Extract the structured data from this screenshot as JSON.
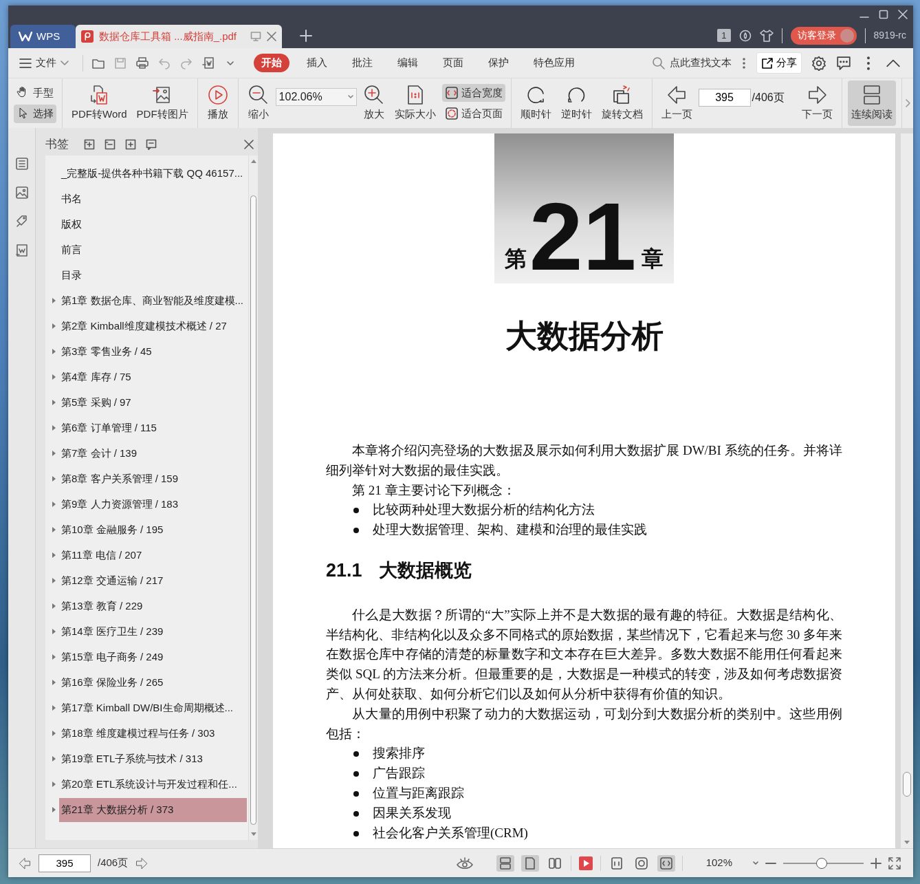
{
  "window": {
    "app_tab": "WPS",
    "document_tab": "数据仓库工具箱 ...威指南_.pdf",
    "window_count": "1",
    "login_button": "访客登录",
    "user_name": "8919-rc"
  },
  "menu": {
    "file": "文件",
    "tabs": [
      {
        "label": "开始",
        "selected": true
      },
      {
        "label": "插入",
        "selected": false
      },
      {
        "label": "批注",
        "selected": false
      },
      {
        "label": "编辑",
        "selected": false
      },
      {
        "label": "页面",
        "selected": false
      },
      {
        "label": "保护",
        "selected": false
      },
      {
        "label": "特色应用",
        "selected": false
      }
    ],
    "search": {
      "placeholder": "点此查找文本"
    },
    "share": "分享"
  },
  "toolbar": {
    "groups": [
      [
        {
          "kind": "stack",
          "items": [
            {
              "label": "手型",
              "selected": false
            },
            {
              "label": "选择",
              "selected": true
            }
          ]
        }
      ],
      [
        {
          "kind": "large",
          "label": "PDF转Word",
          "selected": false
        },
        {
          "kind": "large",
          "label": "PDF转图片",
          "selected": false
        }
      ],
      [
        {
          "kind": "large",
          "label": "播放",
          "selected": false
        }
      ],
      [
        {
          "kind": "large",
          "label": "缩小",
          "selected": false
        },
        {
          "kind": "field",
          "value": "102.06%"
        },
        {
          "kind": "large",
          "label": "放大",
          "selected": false
        },
        {
          "kind": "large",
          "label": "实际大小",
          "selected": false
        },
        {
          "kind": "stack",
          "items": [
            {
              "label": "适合宽度",
              "selected": true
            },
            {
              "label": "适合页面",
              "selected": false
            }
          ]
        }
      ],
      [
        {
          "kind": "large",
          "label": "顺时针",
          "selected": false
        },
        {
          "kind": "large",
          "label": "逆时针",
          "selected": false
        },
        {
          "kind": "large",
          "label": "旋转文档",
          "selected": false
        }
      ],
      [
        {
          "kind": "large",
          "label": "上一页",
          "selected": false
        },
        {
          "kind": "page",
          "value": "395",
          "total": "/406页"
        },
        {
          "kind": "large",
          "label": "下一页",
          "selected": false
        }
      ],
      [
        {
          "kind": "large",
          "label": "连续阅读",
          "selected": true
        }
      ]
    ]
  },
  "bookmarks": {
    "title": "书签",
    "items": [
      {
        "label": "_完整版-提供各种书籍下载 QQ 46157...",
        "expandable": false,
        "selected": false
      },
      {
        "label": "书名",
        "expandable": false,
        "selected": false
      },
      {
        "label": "版权",
        "expandable": false,
        "selected": false
      },
      {
        "label": "前言",
        "expandable": false,
        "selected": false
      },
      {
        "label": "目录",
        "expandable": false,
        "selected": false
      },
      {
        "label": "第1章 数据仓库、商业智能及维度建模...",
        "expandable": true,
        "selected": false
      },
      {
        "label": "第2章 Kimball维度建模技术概述 / 27",
        "expandable": true,
        "selected": false
      },
      {
        "label": "第3章 零售业务 / 45",
        "expandable": true,
        "selected": false
      },
      {
        "label": "第4章 库存 / 75",
        "expandable": true,
        "selected": false
      },
      {
        "label": "第5章 采购 / 97",
        "expandable": true,
        "selected": false
      },
      {
        "label": "第6章 订单管理 / 115",
        "expandable": true,
        "selected": false
      },
      {
        "label": "第7章 会计 / 139",
        "expandable": true,
        "selected": false
      },
      {
        "label": "第8章 客户关系管理 / 159",
        "expandable": true,
        "selected": false
      },
      {
        "label": "第9章 人力资源管理 / 183",
        "expandable": true,
        "selected": false
      },
      {
        "label": "第10章 金融服务 / 195",
        "expandable": true,
        "selected": false
      },
      {
        "label": "第11章 电信 / 207",
        "expandable": true,
        "selected": false
      },
      {
        "label": "第12章 交通运输 / 217",
        "expandable": true,
        "selected": false
      },
      {
        "label": "第13章 教育 / 229",
        "expandable": true,
        "selected": false
      },
      {
        "label": "第14章 医疗卫生 / 239",
        "expandable": true,
        "selected": false
      },
      {
        "label": "第15章 电子商务 / 249",
        "expandable": true,
        "selected": false
      },
      {
        "label": "第16章 保险业务 / 265",
        "expandable": true,
        "selected": false
      },
      {
        "label": "第17章 Kimball DW/BI生命周期概述...",
        "expandable": true,
        "selected": false
      },
      {
        "label": "第18章 维度建模过程与任务 / 303",
        "expandable": true,
        "selected": false
      },
      {
        "label": "第19章 ETL子系统与技术 / 313",
        "expandable": true,
        "selected": false
      },
      {
        "label": "第20章 ETL系统设计与开发过程和任...",
        "expandable": true,
        "selected": false
      },
      {
        "label": "第21章 大数据分析 / 373",
        "expandable": true,
        "selected": true
      }
    ]
  },
  "document": {
    "chapter_prefix": "第",
    "chapter_number": "21",
    "chapter_suffix": "章",
    "chapter_title": "大数据分析",
    "blocks": [
      {
        "kind": "paragraph",
        "text": "本章将介绍闪亮登场的大数据及展示如何利用大数据扩展 DW/BI 系统的任务。并将详细列举针对大数据的最佳实践。"
      },
      {
        "kind": "paragraph",
        "text": "第 21 章主要讨论下列概念："
      },
      {
        "kind": "bullet",
        "text": "比较两种处理大数据分析的结构化方法"
      },
      {
        "kind": "bullet",
        "text": "处理大数据管理、架构、建模和治理的最佳实践"
      },
      {
        "kind": "heading",
        "number": "21.1",
        "text": "大数据概览"
      },
      {
        "kind": "paragraph",
        "text": "什么是大数据？所谓的“大”实际上并不是大数据的最有趣的特征。大数据是结构化、半结构化、非结构化以及众多不同格式的原始数据，某些情况下，它看起来与您 30 多年来在数据仓库中存储的清楚的标量数字和文本存在巨大差异。多数大数据不能用任何看起来类似 SQL 的方法来分析。但最重要的是，大数据是一种模式的转变，涉及如何考虑数据资产、从何处获取、如何分析它们以及如何从分析中获得有价值的知识。"
      },
      {
        "kind": "paragraph",
        "text": "从大量的用例中积聚了动力的大数据运动，可划分到大数据分析的类别中。这些用例包括："
      },
      {
        "kind": "bullet",
        "text": "搜索排序"
      },
      {
        "kind": "bullet",
        "text": "广告跟踪"
      },
      {
        "kind": "bullet",
        "text": "位置与距离跟踪"
      },
      {
        "kind": "bullet",
        "text": "因果关系发现"
      },
      {
        "kind": "bullet",
        "text": "社会化客户关系管理(CRM)"
      }
    ]
  },
  "status_bar": {
    "page": "395",
    "total": "/406页",
    "view_modes": [
      {
        "selected": true
      },
      {
        "selected": true
      },
      {
        "selected": false
      }
    ],
    "fit_modes": [
      {
        "selected": false
      },
      {
        "selected": false
      },
      {
        "selected": true
      }
    ],
    "zoom": "102%",
    "zoom_slider": {
      "level": 0.48
    }
  }
}
